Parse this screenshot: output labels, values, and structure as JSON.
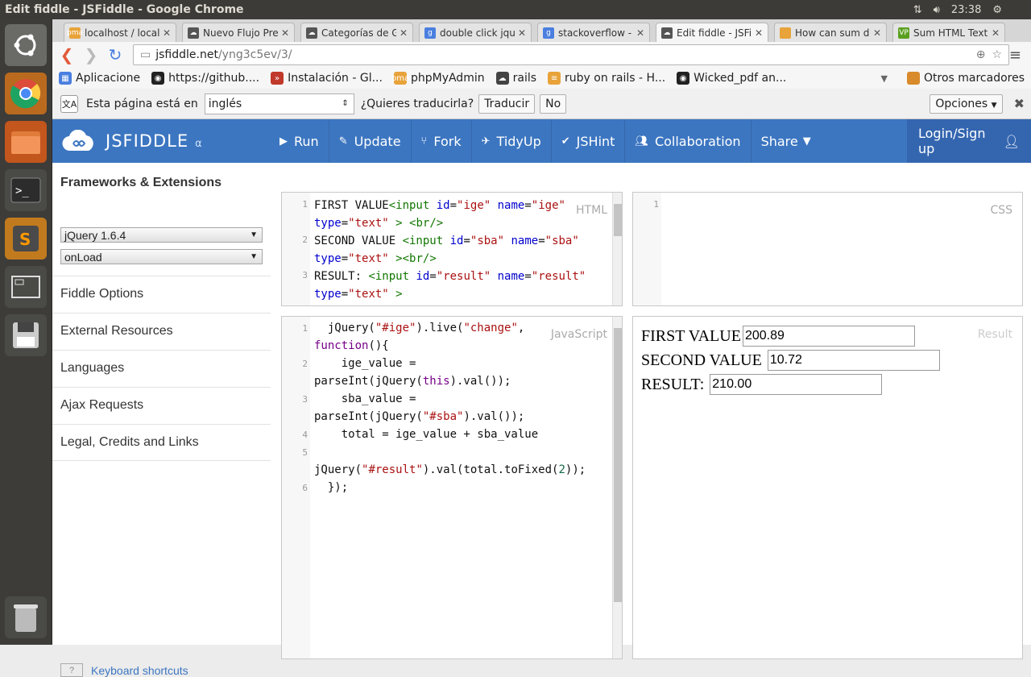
{
  "os": {
    "window_title": "Edit fiddle - JSFiddle - Google Chrome",
    "clock": "23:38"
  },
  "tabs": [
    {
      "label": "localhost / localh",
      "favicon": "pma",
      "color": "#e8a33a"
    },
    {
      "label": "Nuevo Flujo Pres",
      "favicon": "cloud",
      "color": "#555"
    },
    {
      "label": "Categorías de Ga",
      "favicon": "cloud",
      "color": "#555"
    },
    {
      "label": "double click jque",
      "favicon": "g",
      "color": "#4a7fe0"
    },
    {
      "label": "stackoverflow - B",
      "favicon": "g",
      "color": "#4a7fe0"
    },
    {
      "label": "Edit fiddle - JSFic",
      "favicon": "cloud",
      "color": "#555",
      "active": true
    },
    {
      "label": "How can sum dec",
      "favicon": "so",
      "color": "#e8a33a"
    },
    {
      "label": "Sum HTML Textbc",
      "favicon": "vp",
      "color": "#5aa020"
    }
  ],
  "omnibox": {
    "host": "jsfiddle.net",
    "path": "/yng3c5ev/3/"
  },
  "bookmarks": [
    {
      "label": "Aplicacione",
      "icon": "apps-icon"
    },
    {
      "label": "https://github....",
      "icon": "github-icon"
    },
    {
      "label": "Instalación - Gl...",
      "icon": "gitlab-icon"
    },
    {
      "label": "phpMyAdmin",
      "icon": "pma-icon"
    },
    {
      "label": "rails",
      "icon": "cloud-icon"
    },
    {
      "label": "ruby on rails - H...",
      "icon": "so-icon"
    },
    {
      "label": "Wicked_pdf an...",
      "icon": "github-icon"
    }
  ],
  "bookmarks_other": "Otros marcadores",
  "translate": {
    "prefix": "Esta página está en",
    "language": "inglés",
    "question": "¿Quieres traducirla?",
    "translate_btn": "Traducir",
    "no_btn": "No",
    "options_btn": "Opciones"
  },
  "jsfiddle": {
    "logo": "JSFIDDLE",
    "alpha": "α",
    "menu": {
      "run": "Run",
      "update": "Update",
      "fork": "Fork",
      "tidyup": "TidyUp",
      "jshint": "JSHint",
      "collaboration": "Collaboration",
      "share": "Share",
      "login": "Login/Sign up"
    },
    "sidebar": {
      "heading": "Frameworks & Extensions",
      "framework": "jQuery 1.6.4",
      "load": "onLoad",
      "items": [
        "Fiddle Options",
        "External Resources",
        "Languages",
        "Ajax Requests",
        "Legal, Credits and Links"
      ],
      "kbd_q": "?",
      "kbd_label": "Keyboard shortcuts"
    },
    "panels": {
      "html_label": "HTML",
      "css_label": "CSS",
      "js_label": "JavaScript",
      "result_label": "Result"
    },
    "result": {
      "first_label": "FIRST VALUE",
      "first_value": "200.89",
      "second_label": "SECOND VALUE",
      "second_value": "10.72",
      "result_label": "RESULT:",
      "result_value": "210.00"
    },
    "html_lines": [
      "1",
      "2",
      "3"
    ],
    "css_lines": [
      "1"
    ],
    "js_lines": [
      "1",
      "2",
      "3",
      "4",
      "5",
      "6"
    ]
  }
}
